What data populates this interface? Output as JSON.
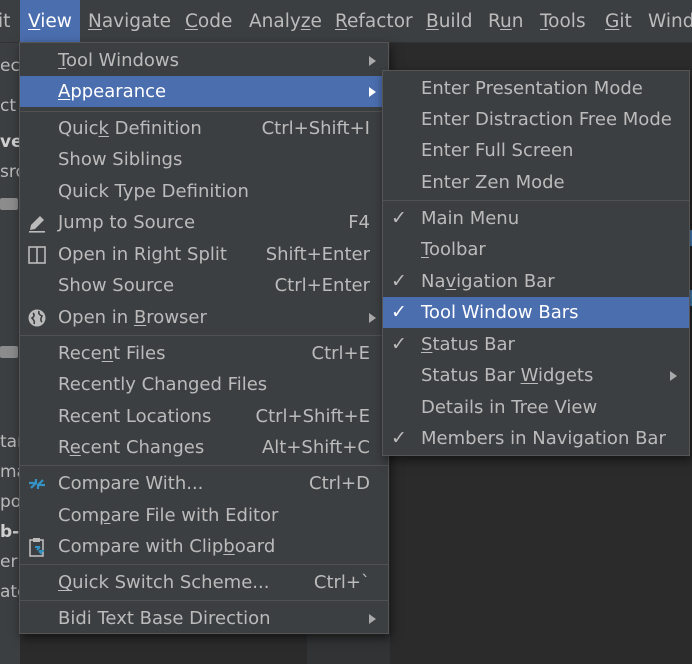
{
  "menubar": {
    "items": [
      {
        "label": "it",
        "mn": ""
      },
      {
        "label": "View",
        "mn": "V"
      },
      {
        "label": "Navigate",
        "mn": "N"
      },
      {
        "label": "Code",
        "mn": "C"
      },
      {
        "label": "Analyze",
        "mn": "z"
      },
      {
        "label": "Refactor",
        "mn": "R"
      },
      {
        "label": "Build",
        "mn": "B"
      },
      {
        "label": "Run",
        "mn": "u"
      },
      {
        "label": "Tools",
        "mn": "T"
      },
      {
        "label": "Git",
        "mn": "G"
      },
      {
        "label": "Wind",
        "mn": ""
      }
    ]
  },
  "ide_fragments": [
    "ect",
    "ct",
    "ve",
    "sro",
    "tar",
    "ma",
    "po",
    "b-c",
    "er",
    "ato"
  ],
  "view_menu": {
    "items": [
      {
        "label": "Tool Windows",
        "mn": "T",
        "shortcut": "",
        "submenu": true
      },
      {
        "label": "Appearance",
        "mn": "A",
        "shortcut": "",
        "submenu": true,
        "selected": true
      },
      {
        "label": "Quick Definition",
        "mn": "k",
        "shortcut": "Ctrl+Shift+I"
      },
      {
        "label": "Show Siblings",
        "shortcut": ""
      },
      {
        "label": "Quick Type Definition",
        "shortcut": ""
      },
      {
        "label": "Jump to Source",
        "shortcut": "F4",
        "icon": "pencil-icon"
      },
      {
        "label": "Open in Right Split",
        "shortcut": "Shift+Enter",
        "icon": "split-view-icon"
      },
      {
        "label": "Show Source",
        "shortcut": "Ctrl+Enter"
      },
      {
        "label": "Open in Browser",
        "mn": "B",
        "shortcut": "",
        "submenu": true,
        "icon": "globe-icon"
      },
      {
        "label": "Recent Files",
        "mn": "n",
        "shortcut": "Ctrl+E"
      },
      {
        "label": "Recently Changed Files",
        "shortcut": ""
      },
      {
        "label": "Recent Locations",
        "shortcut": "Ctrl+Shift+E"
      },
      {
        "label": "Recent Changes",
        "mn": "e",
        "shortcut": "Alt+Shift+C"
      },
      {
        "label": "Compare With...",
        "shortcut": "Ctrl+D",
        "icon": "compare-icon"
      },
      {
        "label": "Compare File with Editor",
        "mn": "p",
        "shortcut": ""
      },
      {
        "label": "Compare with Clipboard",
        "mn": "b",
        "shortcut": "",
        "icon": "clipboard-compare-icon"
      },
      {
        "label": "Quick Switch Scheme...",
        "mn": "Q",
        "shortcut": "Ctrl+`"
      },
      {
        "label": "Bidi Text Base Direction",
        "shortcut": "",
        "submenu": true
      }
    ]
  },
  "appearance_menu": {
    "items": [
      {
        "label": "Enter Presentation Mode",
        "checked": false
      },
      {
        "label": "Enter Distraction Free Mode",
        "checked": false
      },
      {
        "label": "Enter Full Screen",
        "checked": false
      },
      {
        "label": "Enter Zen Mode",
        "checked": false
      },
      {
        "label": "Main Menu",
        "checked": true
      },
      {
        "label": "Toolbar",
        "mn": "T",
        "checked": false
      },
      {
        "label": "Navigation Bar",
        "mn": "v",
        "checked": true
      },
      {
        "label": "Tool Window Bars",
        "checked": true,
        "selected": true
      },
      {
        "label": "Status Bar",
        "mn": "S",
        "checked": true
      },
      {
        "label": "Status Bar Widgets",
        "mn": "W",
        "checked": false,
        "submenu": true
      },
      {
        "label": "Details in Tree View",
        "checked": false
      },
      {
        "label": "Members in Navigation Bar",
        "checked": true
      }
    ],
    "check_glyph": "✓"
  },
  "colors": {
    "menu_bg": "#3c3f41",
    "selection": "#4b6eaf",
    "text": "#bbbbbb",
    "editor_bg": "#2b2b2b"
  }
}
